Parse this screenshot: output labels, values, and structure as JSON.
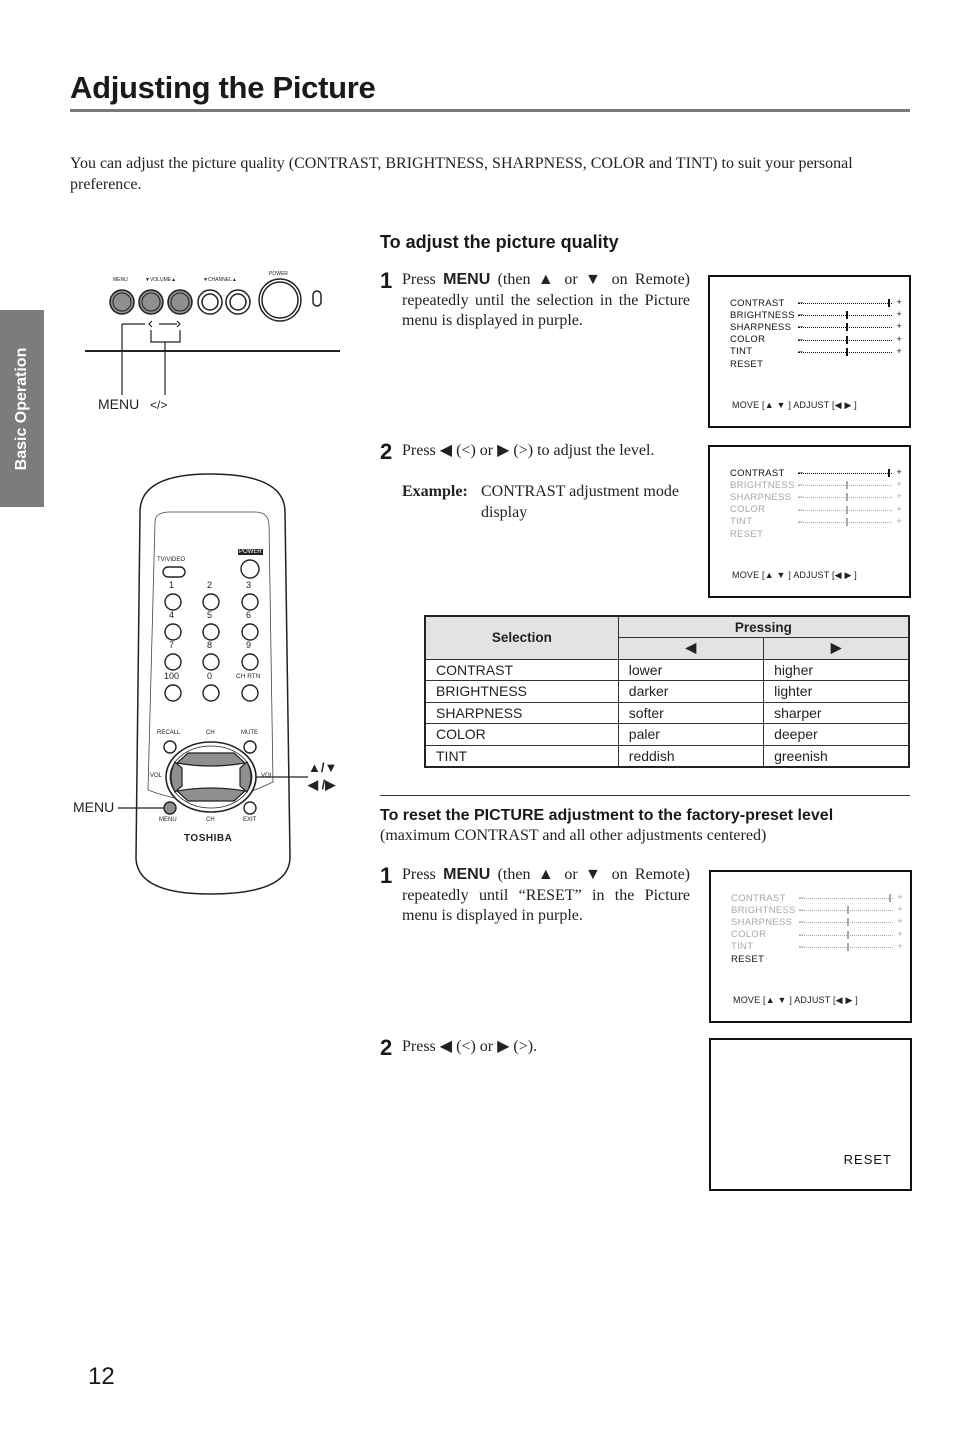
{
  "page": {
    "title": "Adjusting the Picture",
    "intro": "You can adjust the picture quality (CONTRAST, BRIGHTNESS, SHARPNESS, COLOR and TINT) to suit your personal preference.",
    "side_tab": "Basic Operation",
    "page_number": "12"
  },
  "tv_panel": {
    "labels": {
      "menu": "MENU",
      "volume": "▼VOLUME▲",
      "channel": "▼CHANNEL▲",
      "power": "POWER"
    },
    "callout_menu": "MENU",
    "callout_arrows": "</>"
  },
  "remote": {
    "brand": "TOSHIBA",
    "tv_video": "TV/VIDEO",
    "power": "POWER",
    "digits": [
      "1",
      "2",
      "3",
      "4",
      "5",
      "6",
      "7",
      "8",
      "9",
      "100",
      "0",
      "CH RTN"
    ],
    "recall": "RECALL",
    "ch_top": "CH",
    "mute": "MUTE",
    "vol_left": "VOL",
    "vol_right": "VOL",
    "menu": "MENU",
    "ch_bottom": "CH",
    "exit": "EXIT",
    "callout_menu": "MENU",
    "callout_updown": "▲/▼",
    "callout_leftright": "◀ /▶"
  },
  "adjust": {
    "heading": "To adjust the picture quality",
    "step1": {
      "num": "1",
      "pre": "Press ",
      "kw": "MENU",
      "post": " (then ▲ or ▼ on Remote) repeatedly until the selection in the Picture menu is displayed in purple."
    },
    "step2": {
      "num": "2",
      "text": "Press ◀ (<) or ▶ (>) to adjust the level.",
      "example_label": "Example:",
      "example_text": "CONTRAST adjustment mode display"
    }
  },
  "osd": {
    "items": [
      "CONTRAST",
      "BRIGHTNESS",
      "SHARPNESS",
      "COLOR",
      "TINT",
      "RESET"
    ],
    "levels": {
      "CONTRAST": 1.0,
      "BRIGHTNESS": 0.5,
      "SHARPNESS": 0.5,
      "COLOR": 0.5,
      "TINT": 0.5
    },
    "footer": "MOVE [▲ ▼ ]  ADJUST [◀  ▶ ]",
    "minus": "–",
    "plus": "+",
    "reset_screen_text": "RESET"
  },
  "table": {
    "col_selection": "Selection",
    "col_pressing": "Pressing",
    "col_left": "◀",
    "col_right": "▶",
    "rows": [
      {
        "selection": "CONTRAST",
        "left": "lower",
        "right": "higher"
      },
      {
        "selection": "BRIGHTNESS",
        "left": "darker",
        "right": "lighter"
      },
      {
        "selection": "SHARPNESS",
        "left": "softer",
        "right": "sharper"
      },
      {
        "selection": "COLOR",
        "left": "paler",
        "right": "deeper"
      },
      {
        "selection": "TINT",
        "left": "reddish",
        "right": "greenish"
      }
    ]
  },
  "reset": {
    "heading": "To reset the PICTURE adjustment to the factory-preset level",
    "subheading": "(maximum CONTRAST and all other adjustments centered)",
    "step1": {
      "num": "1",
      "pre": "Press ",
      "kw": "MENU",
      "post": " (then ▲ or ▼ on Remote) repeatedly until “RESET” in the Picture menu is displayed in purple."
    },
    "step2": {
      "num": "2",
      "text": "Press ◀ (<) or ▶ (>)."
    }
  }
}
